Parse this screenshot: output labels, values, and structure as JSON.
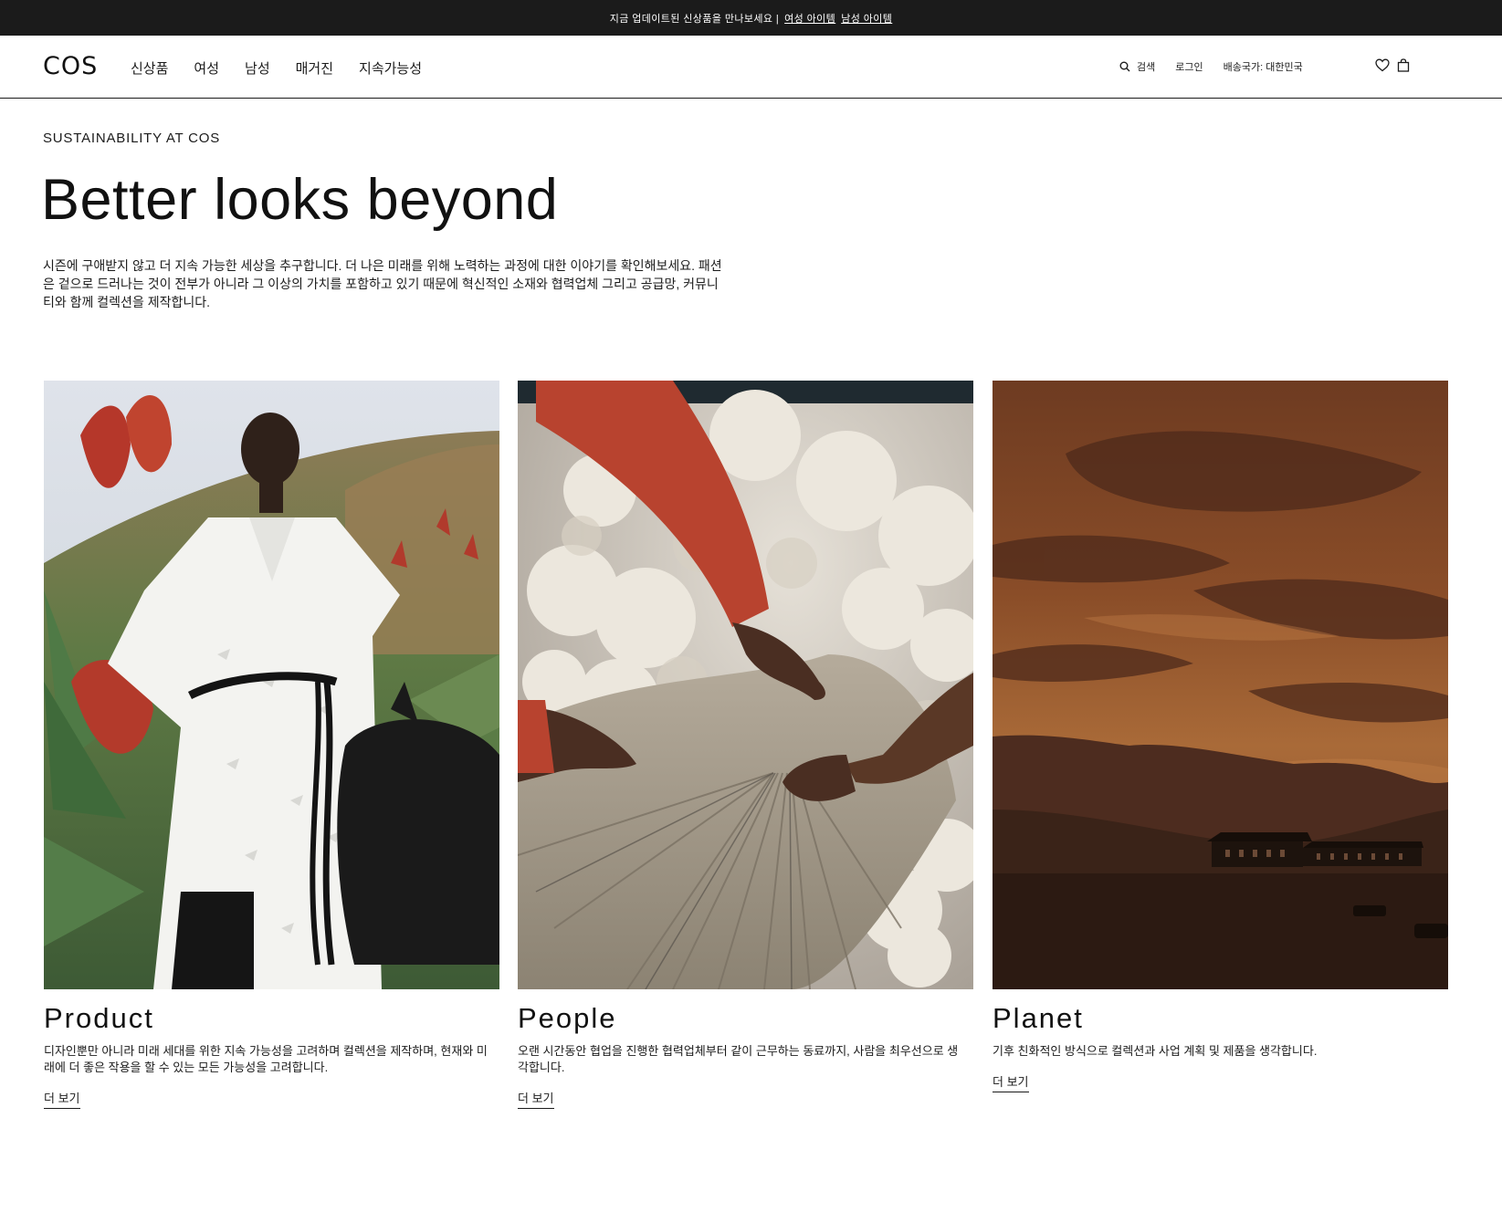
{
  "announcement": {
    "text": "지금 업데이트된 신상품을 만나보세요 |",
    "links": [
      "여성 아이템",
      "남성 아이템"
    ]
  },
  "header": {
    "logo": "COS",
    "nav": [
      "신상품",
      "여성",
      "남성",
      "매거진",
      "지속가능성"
    ],
    "search_label": "검색",
    "login_label": "로그인",
    "country_label": "배송국가: 대한민국",
    "icons": [
      "search-icon",
      "heart-icon",
      "bag-icon"
    ]
  },
  "intro": {
    "eyebrow": "SUSTAINABILITY AT COS",
    "headline": "Better looks beyond",
    "body": "시즌에 구애받지 않고 더 지속 가능한 세상을 추구합니다. 더 나은 미래를 위해 노력하는 과정에 대한 이야기를 확인해보세요. 패션은 겉으로 드러나는 것이 전부가 아니라 그 이상의 가치를 포함하고 있기 때문에 혁신적인 소재와 협력업체 그리고 공급망, 커뮤니티와 함께 컬렉션을 제작합니다."
  },
  "cards": [
    {
      "title": "Product",
      "text": "디자인뿐만 아니라 미래 세대를 위한 지속 가능성을 고려하며 컬렉션을 제작하며, 현재와 미래에 더 좋은 작용을 할 수 있는 모든 가능성을 고려합니다.",
      "link": "더 보기"
    },
    {
      "title": "People",
      "text": "오랜 시간동안 협업을 진행한 협력업체부터 같이 근무하는 동료까지, 사람을 최우선으로 생각합니다.",
      "link": "더 보기"
    },
    {
      "title": "Planet",
      "text": "기후 친화적인 방식으로 컬렉션과 사업 계획 및 제품을 생각합니다.",
      "link": "더 보기"
    }
  ],
  "colors": {
    "bar": "#1b1b1b",
    "text": "#1a1a1a",
    "background": "#ffffff"
  }
}
